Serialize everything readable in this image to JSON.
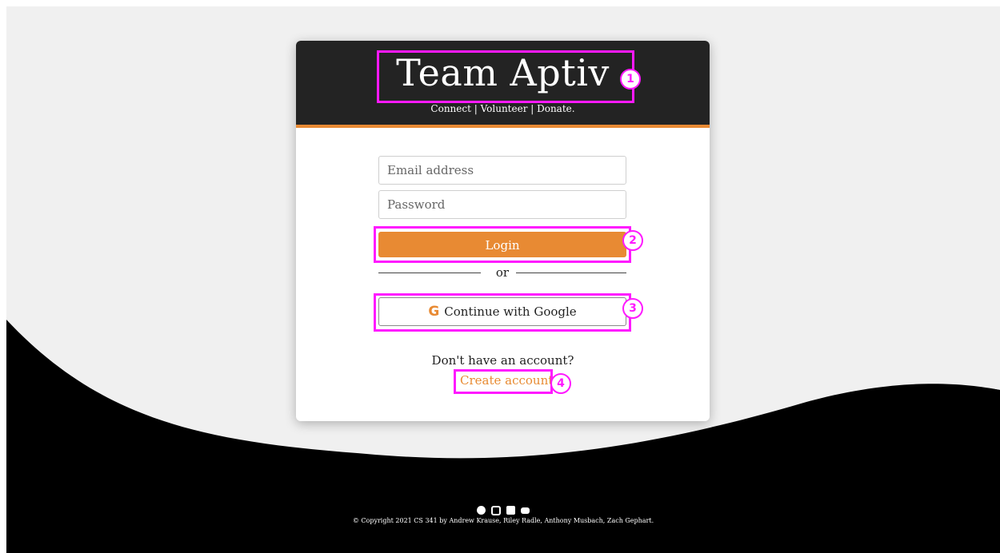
{
  "brand": {
    "title": "Team Aptiv",
    "tagline": "Connect | Volunteer | Donate."
  },
  "form": {
    "email_placeholder": "Email address",
    "password_placeholder": "Password",
    "login_label": "Login",
    "divider_text": "or",
    "google_icon": "G",
    "google_label": "Continue with Google"
  },
  "signup": {
    "prompt": "Don't have an account?",
    "link_label": "Create account"
  },
  "annotations": [
    "1",
    "2",
    "3",
    "4"
  ],
  "footer": {
    "icons": [
      "github-icon",
      "instagram-icon",
      "linkedin-icon",
      "youtube-icon"
    ],
    "copyright": "© Copyright 2021 CS 341 by Andrew Krause, Riley Radle, Anthony Musbach, Zach Gephart."
  },
  "colors": {
    "accent": "#e88a33",
    "header_bg": "#232323",
    "page_bg": "#f0f0f0",
    "wave": "#000000",
    "annotation": "#ff19ff"
  }
}
